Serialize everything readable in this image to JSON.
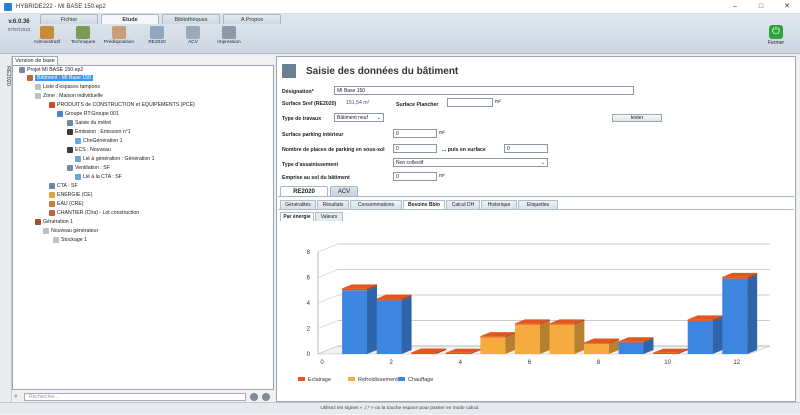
{
  "window": {
    "title": "HYBRIDE222 - MI BASE 150.ep2"
  },
  "ribbon": {
    "version": "v.6.0.36",
    "version_date": "07/07/2023",
    "tabs": [
      "Fichier",
      "Etude",
      "Bibliothèques",
      "A Propos"
    ],
    "active_tab": "Etude",
    "tools": [
      "Administratif",
      "Techniques",
      "Prédisposition",
      "RE2020",
      "ACV",
      "Impression"
    ],
    "quit_label": "Fermer"
  },
  "left": {
    "base_tab": "Version de base",
    "vertical_label": "RE2020",
    "tree": [
      "Projet MI BASE 150.ep2",
      "Bâtiment : MI Base 150",
      "Liste d'espaces tampons",
      "Zone : Maison individuelle",
      "PRODUITS de CONSTRUCTION et EQUIPEMENTS (PCE)",
      "Groupe RT:Groupe 001",
      "Saisie du métré",
      "Emission : Emission n°1",
      "ChnGénération 1",
      "ECS : Nouveau",
      "Lié à génération : Génération 1",
      "Ventilation : SF",
      "Lié à la CTA : SF",
      "CTA : SF",
      "ENERGIE (CE)",
      "EAU (CRE)",
      "CHANTIER (Cha) - Lot construction",
      "Génération 1",
      "Nouveau générateur",
      "Stockage 1"
    ],
    "search_placeholder": "Rechercher..."
  },
  "form": {
    "title": "Saisie des données du bâtiment",
    "designation_label": "Désignation*",
    "designation_value": "MI Base 150",
    "sref_label": "Surface Sref (RE2020)",
    "sref_value": "151,54 m²",
    "plancher_label": "Surface Plancher",
    "plancher_value": "",
    "unit_m2": "m²",
    "travaux_label": "Type de travaux",
    "travaux_value": "Bâtiment neuf",
    "tester_label": "tester",
    "parking_int_label": "Surface parking intérieur",
    "parking_int_value": "0",
    "places_label": "Nombre de places de parking en sous-sol",
    "places_value": "0",
    "surface_label": "... puis en surface",
    "surface_value": "0",
    "assain_label": "Type d'assainissement",
    "assain_value": "Non collectif",
    "emprise_label": "Emprise au sol du bâtiment",
    "emprise_value": "0"
  },
  "main_tabs": [
    "RE2020",
    "ACV"
  ],
  "sub_tabs": [
    "Généralités",
    "Résultats",
    "Consommations",
    "Besoins Bbio",
    "Calcul DH",
    "Historique",
    "Etiquettes"
  ],
  "active_sub_tab": "Besoins Bbio",
  "view_tabs": [
    "Par énergie",
    "Valeurs"
  ],
  "status_text": "Utilisez les signes « ,/,* » ou la touche espace pour passer en mode calcul.",
  "chart_data": {
    "type": "bar",
    "title": "",
    "xlabel": "",
    "ylabel": "",
    "x_ticks": [
      "0",
      "2",
      "4",
      "6",
      "8",
      "10",
      "12"
    ],
    "y_ticks": [
      "0",
      "2",
      "4",
      "6",
      "8"
    ],
    "ylim": [
      0,
      8
    ],
    "categories": [
      "1",
      "2",
      "3",
      "4",
      "5",
      "6",
      "7",
      "8",
      "9",
      "10",
      "11",
      "12"
    ],
    "series": [
      {
        "name": "Eclairage",
        "color": "#e2571e",
        "values": [
          0.15,
          0.15,
          0.12,
          0.1,
          0.1,
          0.1,
          0.1,
          0.1,
          0.1,
          0.1,
          0.12,
          0.15
        ]
      },
      {
        "name": "Refroidissement",
        "color": "#f5ab3d",
        "values": [
          0,
          0,
          0,
          0,
          1.3,
          2.3,
          2.3,
          0.8,
          0,
          0,
          0,
          0
        ]
      },
      {
        "name": "Chauffage",
        "color": "#3d86e0",
        "values": [
          5.0,
          4.2,
          0,
          0,
          0,
          0,
          0,
          0,
          0.9,
          0,
          2.6,
          5.9
        ]
      }
    ],
    "legend_position": "bottom-left",
    "grid": true
  }
}
